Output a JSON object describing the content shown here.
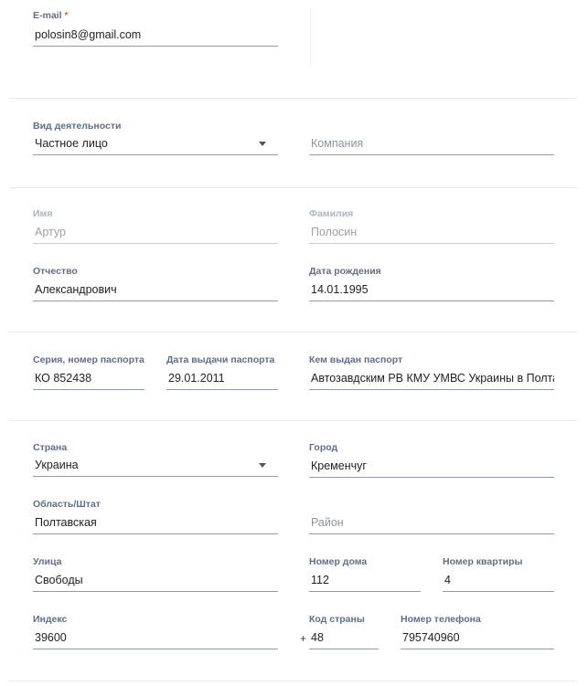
{
  "form": {
    "email": {
      "label": "E-mail",
      "required_mark": "*",
      "value": "polosin8@gmail.com"
    },
    "activity": {
      "label": "Вид деятельности",
      "value": "Частное лицо"
    },
    "company": {
      "placeholder": "Компания"
    },
    "first_name": {
      "label": "Имя",
      "value": "Артур"
    },
    "last_name": {
      "label": "Фамилия",
      "value": "Полосин"
    },
    "patronymic": {
      "label": "Отчество",
      "value": "Александрович"
    },
    "birth_date": {
      "label": "Дата рождения",
      "value": "14.01.1995"
    },
    "passport_number": {
      "label": "Серия, номер паспорта",
      "value": "КО 852438"
    },
    "passport_date": {
      "label": "Дата выдачи паспорта",
      "value": "29.01.2011"
    },
    "passport_issuer": {
      "label": "Кем выдан паспорт",
      "value": "Автозавдским РВ КМУ УМВС Украины в Полтавской"
    },
    "country": {
      "label": "Страна",
      "value": "Украина"
    },
    "city": {
      "label": "Город",
      "value": "Кременчуг"
    },
    "region": {
      "label": "Область/Штат",
      "value": "Полтавская"
    },
    "district": {
      "placeholder": "Район"
    },
    "street": {
      "label": "Улица",
      "value": "Свободы"
    },
    "house": {
      "label": "Номер дома",
      "value": "112"
    },
    "apartment": {
      "label": "Номер квартиры",
      "value": "4"
    },
    "postal_code": {
      "label": "Индекс",
      "value": "39600"
    },
    "country_code": {
      "label": "Код страны",
      "prefix": "+",
      "value": "48"
    },
    "phone": {
      "label": "Номер телефона",
      "value": "795740960"
    }
  }
}
